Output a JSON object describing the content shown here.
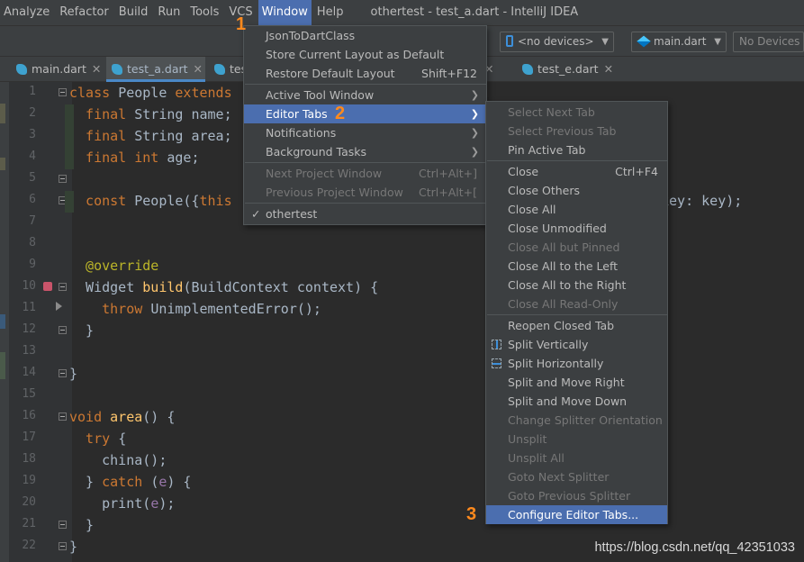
{
  "menubar": {
    "items": [
      "Analyze",
      "Refactor",
      "Build",
      "Run",
      "Tools",
      "VCS",
      "Window",
      "Help"
    ],
    "active_index": 6,
    "window_title": "othertest - test_a.dart - IntelliJ IDEA"
  },
  "toolbar": {
    "device_combo": "<no devices>",
    "run_config_combo": "main.dart",
    "devices_button": "No Devices"
  },
  "tabs": [
    {
      "label": "main.dart",
      "active": false
    },
    {
      "label": "test_a.dart",
      "active": true
    },
    {
      "label": "tes",
      "active": false
    },
    {
      "label": "test_e.dart",
      "active": false
    }
  ],
  "editor": {
    "line_numbers": [
      "1",
      "2",
      "3",
      "4",
      "5",
      "6",
      "7",
      "8",
      "9",
      "10",
      "11",
      "12",
      "13",
      "14",
      "15",
      "16",
      "17",
      "18",
      "19",
      "20",
      "21",
      "22"
    ],
    "lines": [
      [
        {
          "t": "class ",
          "c": "kw"
        },
        {
          "t": "People ",
          "c": "ty"
        },
        {
          "t": "extends",
          "c": "kw"
        }
      ],
      [
        {
          "t": "  final ",
          "c": "kw"
        },
        {
          "t": "String ",
          "c": "ty"
        },
        {
          "t": "name;",
          "c": "ty"
        }
      ],
      [
        {
          "t": "  final ",
          "c": "kw"
        },
        {
          "t": "String ",
          "c": "ty"
        },
        {
          "t": "area;",
          "c": "ty"
        }
      ],
      [
        {
          "t": "  final ",
          "c": "kw"
        },
        {
          "t": "int ",
          "c": "kw"
        },
        {
          "t": "age;",
          "c": "ty"
        }
      ],
      [],
      [
        {
          "t": "  const ",
          "c": "kw"
        },
        {
          "t": "People({",
          "c": "ty"
        },
        {
          "t": "this",
          "c": "kw"
        }
      ],
      [],
      [],
      [
        {
          "t": "  @override",
          "c": "ann"
        }
      ],
      [
        {
          "t": "  Widget ",
          "c": "ty"
        },
        {
          "t": "build",
          "c": "fn"
        },
        {
          "t": "(BuildContext context) {",
          "c": "ty"
        }
      ],
      [
        {
          "t": "    throw ",
          "c": "kw"
        },
        {
          "t": "UnimplementedError();",
          "c": "ty"
        }
      ],
      [
        {
          "t": "  }",
          "c": "ty"
        }
      ],
      [],
      [
        {
          "t": "}",
          "c": "ty"
        }
      ],
      [],
      [
        {
          "t": "void ",
          "c": "kw"
        },
        {
          "t": "area",
          "c": "fn"
        },
        {
          "t": "() {",
          "c": "ty"
        }
      ],
      [
        {
          "t": "  try ",
          "c": "kw"
        },
        {
          "t": "{",
          "c": "ty"
        }
      ],
      [
        {
          "t": "    china",
          "c": "ty"
        },
        {
          "t": "();",
          "c": "ty"
        }
      ],
      [
        {
          "t": "  } ",
          "c": "ty"
        },
        {
          "t": "catch ",
          "c": "kw"
        },
        {
          "t": "(",
          "c": "ty"
        },
        {
          "t": "e",
          "c": "pur"
        },
        {
          "t": ") {",
          "c": "ty"
        }
      ],
      [
        {
          "t": "    print(",
          "c": "ty"
        },
        {
          "t": "e",
          "c": "pur"
        },
        {
          "t": ");",
          "c": "ty"
        }
      ],
      [
        {
          "t": "  }",
          "c": "ty"
        }
      ],
      [
        {
          "t": "}",
          "c": "ty"
        }
      ]
    ],
    "line6_tail": "key: key);"
  },
  "window_menu": {
    "items": [
      {
        "label": "JsonToDartClass",
        "shortcut": "",
        "state": "normal",
        "submenu": false
      },
      {
        "label": "Store Current Layout as Default",
        "shortcut": "",
        "state": "normal",
        "submenu": false
      },
      {
        "label": "Restore Default Layout",
        "shortcut": "Shift+F12",
        "state": "normal",
        "submenu": false
      },
      {
        "sep": true
      },
      {
        "label": "Active Tool Window",
        "shortcut": "",
        "state": "normal",
        "submenu": true
      },
      {
        "label": "Editor Tabs",
        "shortcut": "",
        "state": "selected",
        "submenu": true
      },
      {
        "label": "Notifications",
        "shortcut": "",
        "state": "normal",
        "submenu": true
      },
      {
        "label": "Background Tasks",
        "shortcut": "",
        "state": "normal",
        "submenu": true
      },
      {
        "sep": true
      },
      {
        "label": "Next Project Window",
        "shortcut": "Ctrl+Alt+]",
        "state": "disabled",
        "submenu": false
      },
      {
        "label": "Previous Project Window",
        "shortcut": "Ctrl+Alt+[",
        "state": "disabled",
        "submenu": false
      },
      {
        "sep": true
      },
      {
        "label": "othertest",
        "shortcut": "",
        "state": "checked",
        "submenu": false
      }
    ]
  },
  "editor_tabs_menu": {
    "items": [
      {
        "label": "Select Next Tab",
        "shortcut": "",
        "state": "disabled",
        "icon": ""
      },
      {
        "label": "Select Previous Tab",
        "shortcut": "",
        "state": "disabled",
        "icon": ""
      },
      {
        "label": "Pin Active Tab",
        "shortcut": "",
        "state": "normal",
        "icon": ""
      },
      {
        "sep": true
      },
      {
        "label": "Close",
        "shortcut": "Ctrl+F4",
        "state": "normal",
        "icon": ""
      },
      {
        "label": "Close Others",
        "shortcut": "",
        "state": "normal",
        "icon": ""
      },
      {
        "label": "Close All",
        "shortcut": "",
        "state": "normal",
        "icon": ""
      },
      {
        "label": "Close Unmodified",
        "shortcut": "",
        "state": "normal",
        "icon": ""
      },
      {
        "label": "Close All but Pinned",
        "shortcut": "",
        "state": "disabled",
        "icon": ""
      },
      {
        "label": "Close All to the Left",
        "shortcut": "",
        "state": "normal",
        "icon": ""
      },
      {
        "label": "Close All to the Right",
        "shortcut": "",
        "state": "normal",
        "icon": ""
      },
      {
        "label": "Close All Read-Only",
        "shortcut": "",
        "state": "disabled",
        "icon": ""
      },
      {
        "sep": true
      },
      {
        "label": "Reopen Closed Tab",
        "shortcut": "",
        "state": "normal",
        "icon": ""
      },
      {
        "label": "Split Vertically",
        "shortcut": "",
        "state": "normal",
        "icon": "split-vertical-icon"
      },
      {
        "label": "Split Horizontally",
        "shortcut": "",
        "state": "normal",
        "icon": "split-horizontal-icon"
      },
      {
        "label": "Split and Move Right",
        "shortcut": "",
        "state": "normal",
        "icon": ""
      },
      {
        "label": "Split and Move Down",
        "shortcut": "",
        "state": "normal",
        "icon": ""
      },
      {
        "label": "Change Splitter Orientation",
        "shortcut": "",
        "state": "disabled",
        "icon": ""
      },
      {
        "label": "Unsplit",
        "shortcut": "",
        "state": "disabled",
        "icon": ""
      },
      {
        "label": "Unsplit All",
        "shortcut": "",
        "state": "disabled",
        "icon": ""
      },
      {
        "label": "Goto Next Splitter",
        "shortcut": "",
        "state": "disabled",
        "icon": ""
      },
      {
        "label": "Goto Previous Splitter",
        "shortcut": "",
        "state": "disabled",
        "icon": ""
      },
      {
        "label": "Configure Editor Tabs...",
        "shortcut": "",
        "state": "selected",
        "icon": ""
      }
    ]
  },
  "step_markers": [
    "1",
    "2",
    "3"
  ],
  "watermark": "https://blog.csdn.net/qq_42351033",
  "colors": {
    "accent_selection": "#4b6eaf",
    "keyword": "#cc7832",
    "function": "#ffc66d",
    "annotation": "#bbb529",
    "step_marker": "#ff8a1d"
  }
}
